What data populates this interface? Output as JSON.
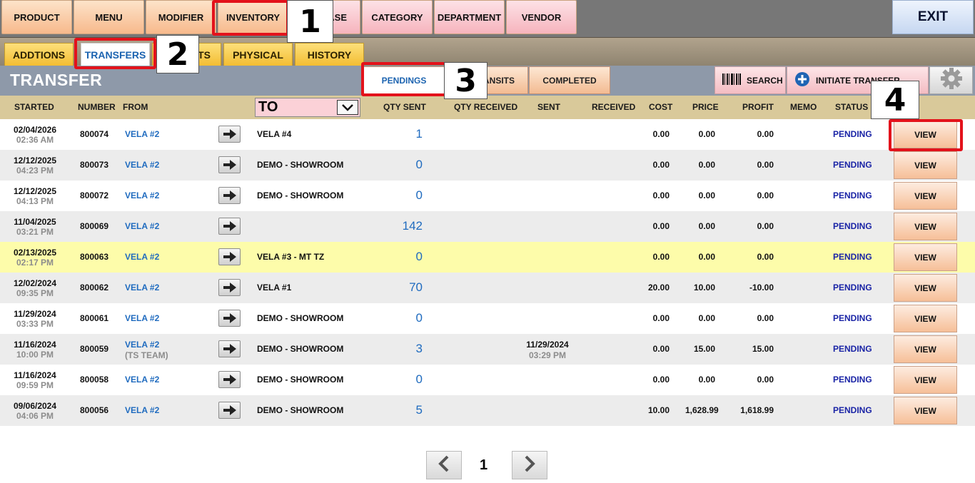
{
  "nav": {
    "items": [
      {
        "label": "PRODUCT",
        "style": "orange"
      },
      {
        "label": "MENU",
        "style": "orange"
      },
      {
        "label": "MODIFIER",
        "style": "orange"
      },
      {
        "label": "INVENTORY",
        "style": "orange"
      },
      {
        "label": "ASE",
        "style": "pink"
      },
      {
        "label": "CATEGORY",
        "style": "pink"
      },
      {
        "label": "DEPARTMENT",
        "style": "pink"
      },
      {
        "label": "VENDOR",
        "style": "pink"
      }
    ],
    "exit_label": "EXIT"
  },
  "subtabs": {
    "items": [
      "ADDTIONS",
      "TRANSFERS",
      "TS",
      "PHYSICAL",
      "HISTORY"
    ]
  },
  "section": {
    "title": "TRANSFER",
    "tabs": [
      "PENDINGS",
      "ANSITS",
      "COMPLETED"
    ],
    "search_label": "SEARCH",
    "initiate_label": "INITIATE TRANSFER"
  },
  "columns": {
    "started": "STARTED",
    "number": "NUMBER",
    "from": "FROM",
    "to": "TO",
    "qty_sent": "QTY SENT",
    "qty_received": "QTY RECEIVED",
    "sent": "SENT",
    "received": "RECEIVED",
    "cost": "COST",
    "price": "PRICE",
    "profit": "PROFIT",
    "memo": "MEMO",
    "status": "STATUS"
  },
  "rows": [
    {
      "date": "02/04/2026",
      "time": "02:36 AM",
      "number": "800074",
      "from": "VELA #2",
      "from_sub": "",
      "to": "VELA #4",
      "qty": "1",
      "sent_date": "",
      "sent_time": "",
      "cost": "0.00",
      "price": "0.00",
      "profit": "0.00",
      "status": "PENDING",
      "view": "VIEW",
      "bg": "white"
    },
    {
      "date": "12/12/2025",
      "time": "04:23 PM",
      "number": "800073",
      "from": "VELA #2",
      "from_sub": "",
      "to": "DEMO - SHOWROOM",
      "qty": "0",
      "sent_date": "",
      "sent_time": "",
      "cost": "0.00",
      "price": "0.00",
      "profit": "0.00",
      "status": "PENDING",
      "view": "VIEW",
      "bg": "gray"
    },
    {
      "date": "12/12/2025",
      "time": "04:13 PM",
      "number": "800072",
      "from": "VELA #2",
      "from_sub": "",
      "to": "DEMO - SHOWROOM",
      "qty": "0",
      "sent_date": "",
      "sent_time": "",
      "cost": "0.00",
      "price": "0.00",
      "profit": "0.00",
      "status": "PENDING",
      "view": "VIEW",
      "bg": "white"
    },
    {
      "date": "11/04/2025",
      "time": "03:21 PM",
      "number": "800069",
      "from": "VELA #2",
      "from_sub": "",
      "to": "",
      "qty": "142",
      "sent_date": "",
      "sent_time": "",
      "cost": "0.00",
      "price": "0.00",
      "profit": "0.00",
      "status": "PENDING",
      "view": "VIEW",
      "bg": "gray"
    },
    {
      "date": "02/13/2025",
      "time": "02:17 PM",
      "number": "800063",
      "from": "VELA #2",
      "from_sub": "",
      "to": "VELA #3 - MT TZ",
      "qty": "0",
      "sent_date": "",
      "sent_time": "",
      "cost": "0.00",
      "price": "0.00",
      "profit": "0.00",
      "status": "PENDING",
      "view": "VIEW",
      "bg": "yellow"
    },
    {
      "date": "12/02/2024",
      "time": "09:35 PM",
      "number": "800062",
      "from": "VELA #2",
      "from_sub": "",
      "to": "VELA #1",
      "qty": "70",
      "sent_date": "",
      "sent_time": "",
      "cost": "20.00",
      "price": "10.00",
      "profit": "-10.00",
      "status": "PENDING",
      "view": "VIEW",
      "bg": "gray"
    },
    {
      "date": "11/29/2024",
      "time": "03:33 PM",
      "number": "800061",
      "from": "VELA #2",
      "from_sub": "",
      "to": "DEMO - SHOWROOM",
      "qty": "0",
      "sent_date": "",
      "sent_time": "",
      "cost": "0.00",
      "price": "0.00",
      "profit": "0.00",
      "status": "PENDING",
      "view": "VIEW",
      "bg": "white"
    },
    {
      "date": "11/16/2024",
      "time": "10:00 PM",
      "number": "800059",
      "from": "VELA #2",
      "from_sub": "(TS TEAM)",
      "to": "DEMO - SHOWROOM",
      "qty": "3",
      "sent_date": "11/29/2024",
      "sent_time": "03:29 PM",
      "cost": "0.00",
      "price": "15.00",
      "profit": "15.00",
      "status": "PENDING",
      "view": "VIEW",
      "bg": "gray"
    },
    {
      "date": "11/16/2024",
      "time": "09:59 PM",
      "number": "800058",
      "from": "VELA #2",
      "from_sub": "",
      "to": "DEMO - SHOWROOM",
      "qty": "0",
      "sent_date": "",
      "sent_time": "",
      "cost": "0.00",
      "price": "0.00",
      "profit": "0.00",
      "status": "PENDING",
      "view": "VIEW",
      "bg": "white"
    },
    {
      "date": "09/06/2024",
      "time": "04:06 PM",
      "number": "800056",
      "from": "VELA #2",
      "from_sub": "",
      "to": "DEMO - SHOWROOM",
      "qty": "5",
      "sent_date": "",
      "sent_time": "",
      "cost": "10.00",
      "price": "1,628.99",
      "profit": "1,618.99",
      "status": "PENDING",
      "view": "VIEW",
      "bg": "gray"
    }
  ],
  "pager": {
    "page": "1"
  },
  "callouts": [
    "1",
    "2",
    "3",
    "4"
  ],
  "colors": {
    "accent_blue": "#1f6bbf",
    "status_blue": "#1a24a6",
    "callout_red": "#e3121b"
  }
}
